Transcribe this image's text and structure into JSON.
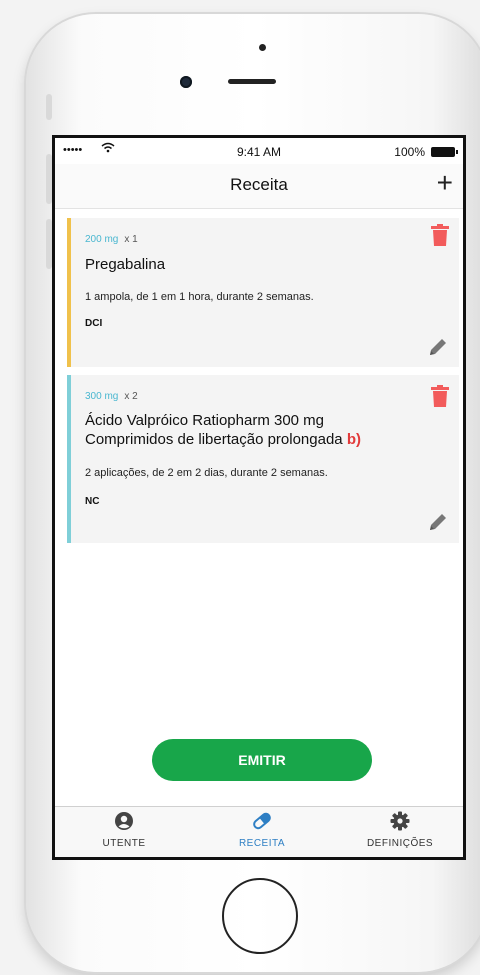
{
  "status_bar": {
    "time": "9:41 AM",
    "battery": "100%",
    "signal": "•••••"
  },
  "nav": {
    "title": "Receita",
    "add_label": "+"
  },
  "prescriptions": [
    {
      "dose": "200 mg",
      "quantity": "x 1",
      "name_line1": "Pregabalina",
      "name_line2": "",
      "flag": "",
      "instructions": "1 ampola, de 1 em 1 hora, durante 2 semanas.",
      "code": "DCI",
      "accent_color": "#f0c14b"
    },
    {
      "dose": "300 mg",
      "quantity": "x 2",
      "name_line1": "Ácido Valpróico Ratiopharm 300 mg",
      "name_line2": "Comprimidos de libertação prolongada",
      "flag": "b)",
      "instructions": "2 aplicações, de 2 em 2 dias, durante 2 semanas.",
      "code": "NC",
      "accent_color": "#7fcfd8"
    }
  ],
  "emit_button": {
    "label": "EMITIR",
    "color": "#18a64a"
  },
  "tabs": [
    {
      "label": "UTENTE",
      "icon": "user-icon",
      "active": false
    },
    {
      "label": "RECEITA",
      "icon": "pill-icon",
      "active": true
    },
    {
      "label": "DEFINIÇÕES",
      "icon": "gear-icon",
      "active": false
    }
  ],
  "colors": {
    "delete": "#f25b5b",
    "active_tab": "#2e7fc4",
    "dose_text": "#4ab7d0"
  }
}
